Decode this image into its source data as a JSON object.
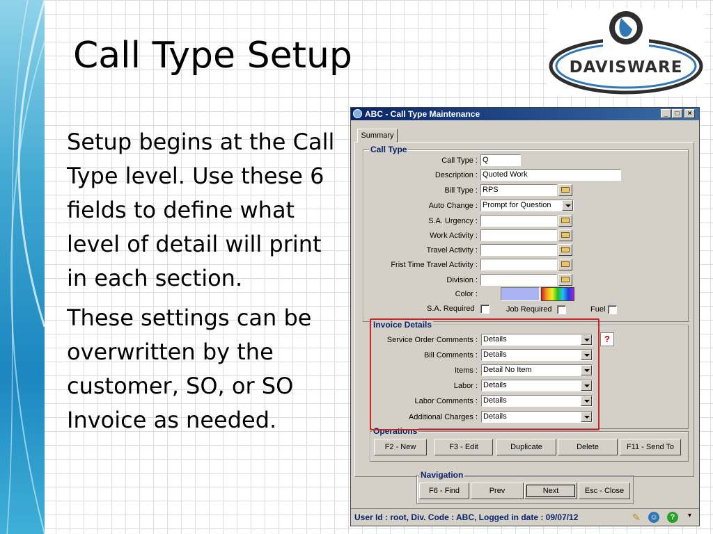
{
  "slide": {
    "title": "Call Type Setup",
    "paragraphs": [
      "Setup begins at the Call Type level.  Use these 6 fields to define what level of detail will print in each section.",
      "These settings can be overwritten by the customer, SO, or SO Invoice as needed."
    ],
    "logo_text": "DAVISWARE"
  },
  "window": {
    "title": "ABC - Call Type Maintenance",
    "tab": "Summary",
    "call_type_group": {
      "legend": "Call Type",
      "fields": [
        {
          "label": "Call Type :",
          "value": "Q"
        },
        {
          "label": "Description :",
          "value": "Quoted Work"
        },
        {
          "label": "Bill Type :",
          "value": "RPS"
        },
        {
          "label": "Auto Change :",
          "value": "Prompt for Question"
        },
        {
          "label": "S.A. Urgency :",
          "value": ""
        },
        {
          "label": "Work Activity :",
          "value": ""
        },
        {
          "label": "Travel Activity :",
          "value": ""
        },
        {
          "label": "Frist Time Travel Activity :",
          "value": ""
        },
        {
          "label": "Division :",
          "value": ""
        },
        {
          "label": "Color :",
          "value": ""
        }
      ],
      "checkboxes": [
        {
          "label": "S.A. Required",
          "checked": false
        },
        {
          "label": "Job Required",
          "checked": false
        },
        {
          "label": "Fuel",
          "checked": false
        }
      ],
      "color_swatch": "#aab4f0"
    },
    "invoice_group": {
      "legend": "Invoice Details",
      "fields": [
        {
          "label": "Service Order Comments :",
          "value": "Details"
        },
        {
          "label": "Bill Comments :",
          "value": "Details"
        },
        {
          "label": "Items :",
          "value": "Detail No Item"
        },
        {
          "label": "Labor :",
          "value": "Details"
        },
        {
          "label": "Labor Comments :",
          "value": "Details"
        },
        {
          "label": "Additional Charges :",
          "value": "Details"
        }
      ],
      "help_label": "?"
    },
    "operations_group": {
      "legend": "Operations",
      "buttons": [
        "F2 - New",
        "F3 - Edit",
        "Duplicate",
        "Delete",
        "F11 - Send To"
      ]
    },
    "navigation_group": {
      "legend": "Navigation",
      "buttons": [
        "F6 - Find",
        "Prev",
        "Next",
        "Esc - Close"
      ]
    },
    "status_text": "User Id : root, Div. Code : ABC, Logged in date : 09/07/12"
  },
  "colors": {
    "title_bar": "#0a246a",
    "highlight": "#d02020",
    "group_legend": "#0a246a"
  }
}
